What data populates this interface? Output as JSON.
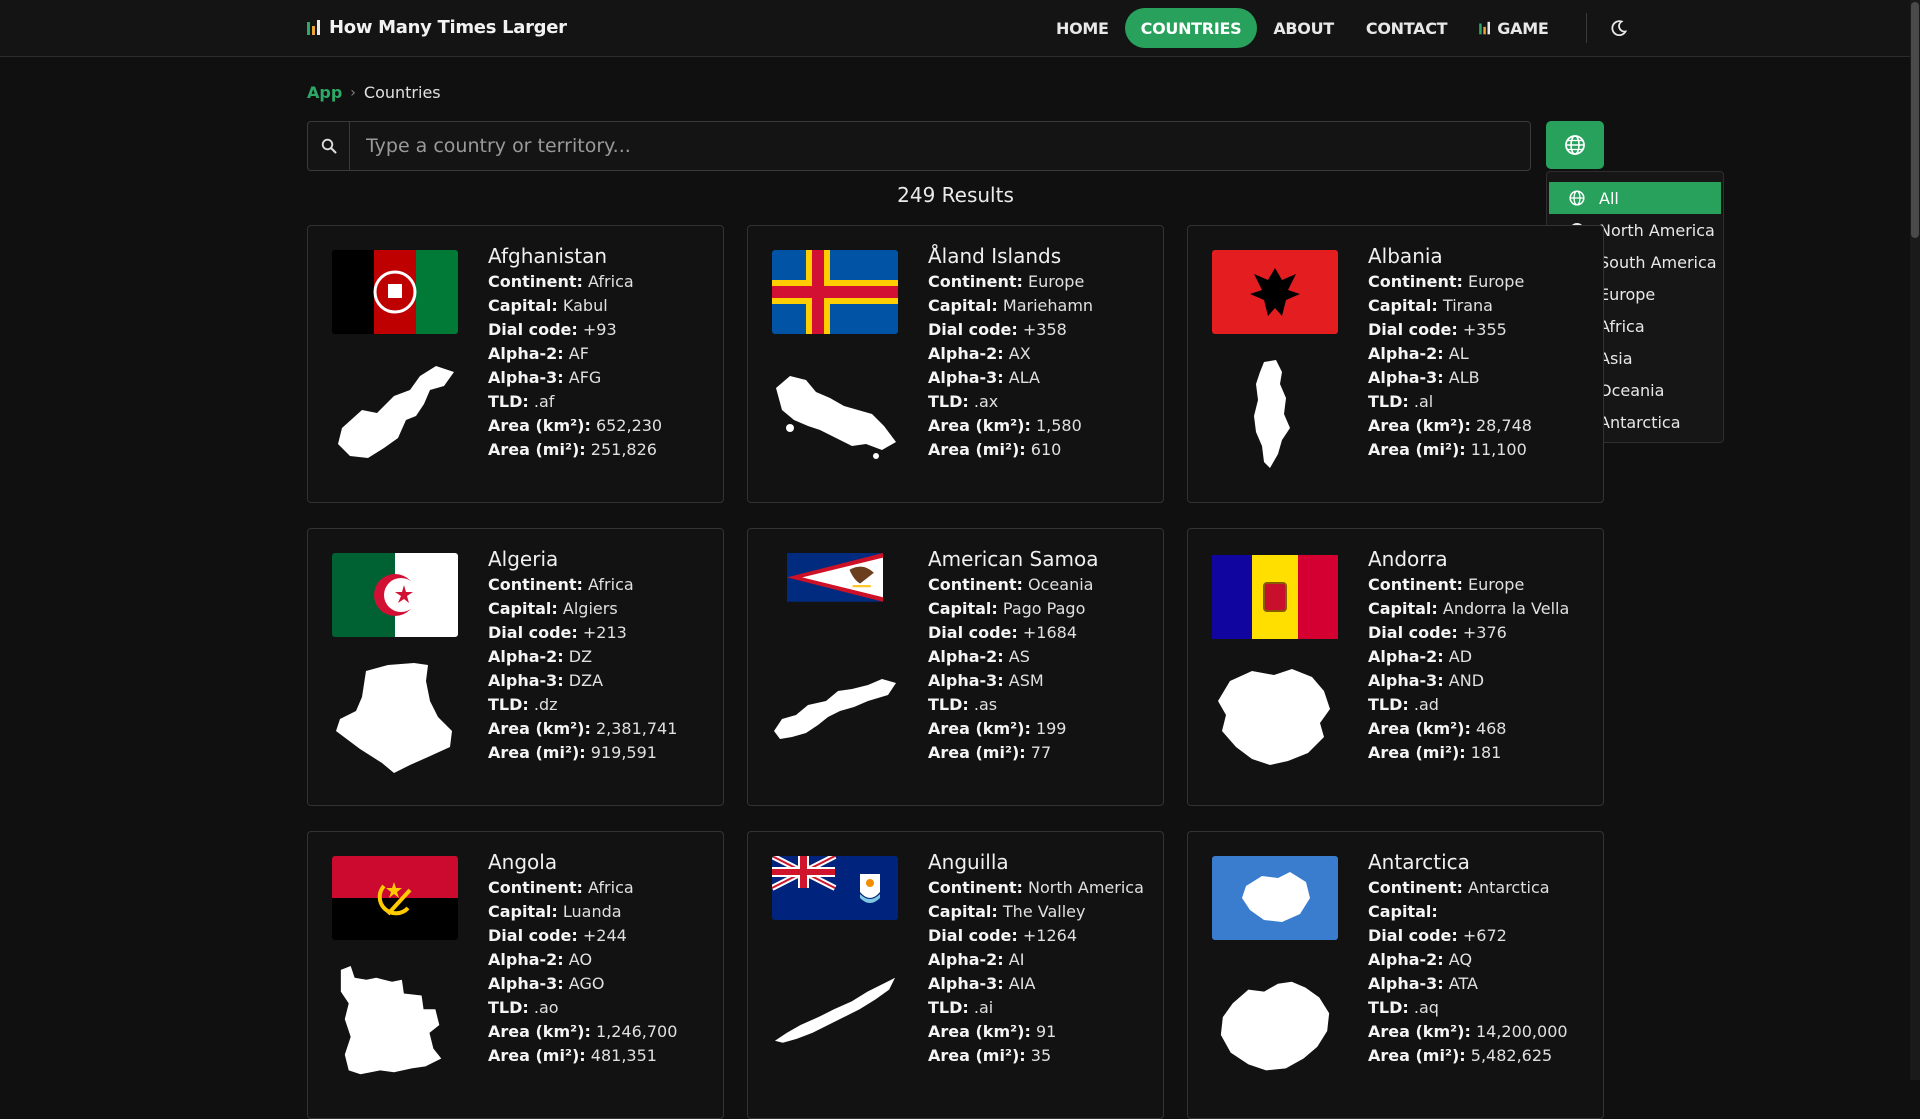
{
  "brand": {
    "title": "How Many Times Larger"
  },
  "nav": {
    "items": [
      {
        "label": "HOME"
      },
      {
        "label": "COUNTRIES"
      },
      {
        "label": "ABOUT"
      },
      {
        "label": "CONTACT"
      },
      {
        "label": "GAME"
      }
    ],
    "active": "COUNTRIES",
    "accent": "#27a15b"
  },
  "breadcrumb": {
    "root": "App",
    "current": "Countries"
  },
  "search": {
    "placeholder": "Type a country or territory..."
  },
  "results_text": "249 Results",
  "continent_filter": {
    "selected": "All",
    "options": [
      {
        "label": "All",
        "icon": "globe-icon"
      },
      {
        "label": "North America",
        "icon": "globe-americas-icon"
      },
      {
        "label": "South America",
        "icon": "globe-americas-icon"
      },
      {
        "label": "Europe",
        "icon": "globe-europe-icon"
      },
      {
        "label": "Africa",
        "icon": "globe-africa-icon"
      },
      {
        "label": "Asia",
        "icon": "globe-asia-icon"
      },
      {
        "label": "Oceania",
        "icon": "globe-oceania-icon"
      },
      {
        "label": "Antarctica",
        "icon": "snowflake-icon"
      }
    ]
  },
  "field_labels": {
    "continent": "Continent:",
    "capital": "Capital:",
    "dial": "Dial code:",
    "alpha2": "Alpha-2:",
    "alpha3": "Alpha-3:",
    "tld": "TLD:",
    "area_km": "Area (km²):",
    "area_mi": "Area (mi²):"
  },
  "countries": [
    {
      "name": "Afghanistan",
      "continent": "Africa",
      "capital": "Kabul",
      "dial": "+93",
      "alpha2": "AF",
      "alpha3": "AFG",
      "tld": ".af",
      "area_km": "652,230",
      "area_mi": "251,826"
    },
    {
      "name": "Åland Islands",
      "continent": "Europe",
      "capital": "Mariehamn",
      "dial": "+358",
      "alpha2": "AX",
      "alpha3": "ALA",
      "tld": ".ax",
      "area_km": "1,580",
      "area_mi": "610"
    },
    {
      "name": "Albania",
      "continent": "Europe",
      "capital": "Tirana",
      "dial": "+355",
      "alpha2": "AL",
      "alpha3": "ALB",
      "tld": ".al",
      "area_km": "28,748",
      "area_mi": "11,100"
    },
    {
      "name": "Algeria",
      "continent": "Africa",
      "capital": "Algiers",
      "dial": "+213",
      "alpha2": "DZ",
      "alpha3": "DZA",
      "tld": ".dz",
      "area_km": "2,381,741",
      "area_mi": "919,591"
    },
    {
      "name": "American Samoa",
      "continent": "Oceania",
      "capital": "Pago Pago",
      "dial": "+1684",
      "alpha2": "AS",
      "alpha3": "ASM",
      "tld": ".as",
      "area_km": "199",
      "area_mi": "77"
    },
    {
      "name": "Andorra",
      "continent": "Europe",
      "capital": "Andorra la Vella",
      "dial": "+376",
      "alpha2": "AD",
      "alpha3": "AND",
      "tld": ".ad",
      "area_km": "468",
      "area_mi": "181"
    },
    {
      "name": "Angola",
      "continent": "Africa",
      "capital": "Luanda",
      "dial": "+244",
      "alpha2": "AO",
      "alpha3": "AGO",
      "tld": ".ao",
      "area_km": "1,246,700",
      "area_mi": "481,351"
    },
    {
      "name": "Anguilla",
      "continent": "North America",
      "capital": "The Valley",
      "dial": "+1264",
      "alpha2": "AI",
      "alpha3": "AIA",
      "tld": ".ai",
      "area_km": "91",
      "area_mi": "35"
    },
    {
      "name": "Antarctica",
      "continent": "Antarctica",
      "capital": "",
      "dial": "+672",
      "alpha2": "AQ",
      "alpha3": "ATA",
      "tld": ".aq",
      "area_km": "14,200,000",
      "area_mi": "5,482,625"
    }
  ]
}
